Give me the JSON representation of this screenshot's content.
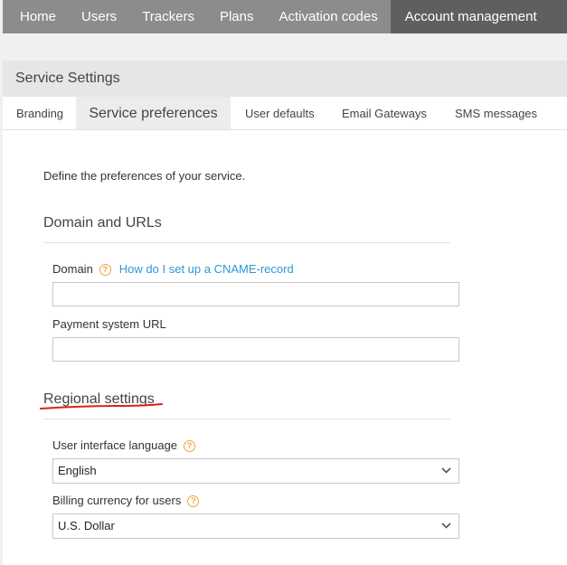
{
  "topnav": {
    "items": [
      "Home",
      "Users",
      "Trackers",
      "Plans",
      "Activation codes",
      "Account management"
    ],
    "active_index": 5
  },
  "panel": {
    "title": "Service Settings"
  },
  "tabs": {
    "items": [
      "Branding",
      "Service preferences",
      "User defaults",
      "Email Gateways",
      "SMS messages"
    ],
    "active_index": 1
  },
  "content": {
    "intro": "Define the preferences of your service.",
    "domain_section": {
      "title": "Domain and URLs",
      "domain_label": "Domain",
      "domain_help_link": "How do I set up a CNAME-record",
      "domain_value": "",
      "payment_label": "Payment system URL",
      "payment_value": ""
    },
    "regional_section": {
      "title": "Regional settings",
      "language_label": "User interface language",
      "language_value": "English",
      "currency_label": "Billing currency for users",
      "currency_value": "U.S. Dollar"
    }
  },
  "icons": {
    "help": "question-circle-icon",
    "dropdown": "chevron-down-icon"
  },
  "colors": {
    "nav_bg": "#8c8c8c",
    "nav_active": "#5f5f5f",
    "help_icon": "#f0a23b",
    "link": "#2d9ad8",
    "annotation": "#e0201a"
  }
}
